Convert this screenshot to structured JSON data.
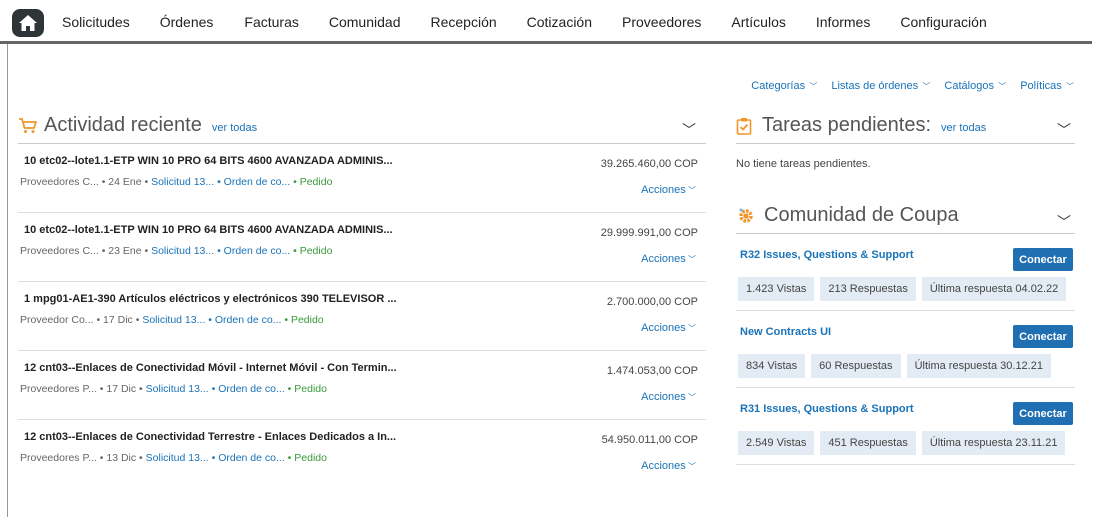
{
  "nav": {
    "home_icon": "home-icon",
    "items": [
      "Solicitudes",
      "Órdenes",
      "Facturas",
      "Comunidad",
      "Recepción",
      "Cotización",
      "Proveedores",
      "Artículos",
      "Informes",
      "Configuración"
    ]
  },
  "sublinks": [
    "Categorías",
    "Listas de órdenes",
    "Catálogos",
    "Políticas"
  ],
  "activity": {
    "title": "Actividad reciente",
    "see_all": "ver todas",
    "rows": [
      {
        "desc": "10 etc02--lote1.1-ETP WIN 10 PRO 64 BITS 4600 AVANZADA ADMINIS...",
        "supplier": "Proveedores C... • 24 Ene •",
        "req": "Solicitud 13...",
        "order": "• Orden de co...",
        "status": "• Pedido",
        "amount": "39.265.460,00 COP",
        "actions": "Acciones"
      },
      {
        "desc": "10 etc02--lote1.1-ETP WIN 10 PRO 64 BITS 4600 AVANZADA ADMINIS...",
        "supplier": "Proveedores C... • 23 Ene •",
        "req": "Solicitud 13...",
        "order": "• Orden de co...",
        "status": "• Pedido",
        "amount": "29.999.991,00 COP",
        "actions": "Acciones"
      },
      {
        "desc": "1 mpg01-AE1-390 Artículos eléctricos y electrónicos 390 TELEVISOR ...",
        "supplier": "Proveedor Co... • 17 Dic •",
        "req": "Solicitud 13...",
        "order": "• Orden de co...",
        "status": "• Pedido",
        "amount": "2.700.000,00 COP",
        "actions": "Acciones"
      },
      {
        "desc": "12 cnt03--Enlaces de Conectividad Móvil - Internet Móvil - Con Termin...",
        "supplier": "Proveedores P... • 17 Dic •",
        "req": "Solicitud 13...",
        "order": "• Orden de co...",
        "status": "• Pedido",
        "amount": "1.474.053,00 COP",
        "actions": "Acciones"
      },
      {
        "desc": "12 cnt03--Enlaces de Conectividad Terrestre - Enlaces Dedicados a In...",
        "supplier": "Proveedores P... • 13 Dic •",
        "req": "Solicitud 13...",
        "order": "• Orden de co...",
        "status": "• Pedido",
        "amount": "54.950.011,00 COP",
        "actions": "Acciones"
      }
    ]
  },
  "tasks": {
    "title": "Tareas pendientes:",
    "see_all": "ver todas",
    "empty": "No tiene tareas pendientes."
  },
  "community": {
    "title": "Comunidad de Coupa",
    "connect_label": "Conectar",
    "items": [
      {
        "title": "R32 Issues, Questions & Support",
        "views": "1.423 Vistas",
        "answers": "213 Respuestas",
        "last": "Última respuesta 04.02.22"
      },
      {
        "title": "New Contracts UI",
        "views": "834 Vistas",
        "answers": "60 Respuestas",
        "last": "Última respuesta 30.12.21"
      },
      {
        "title": "R31 Issues, Questions & Support",
        "views": "2.549 Vistas",
        "answers": "451 Respuestas",
        "last": "Última respuesta 23.11.21"
      }
    ]
  },
  "colors": {
    "link": "#1a73b8",
    "button": "#1f6fb2",
    "status_ok": "#3a9a3a",
    "accent_orange": "#f0962a"
  }
}
